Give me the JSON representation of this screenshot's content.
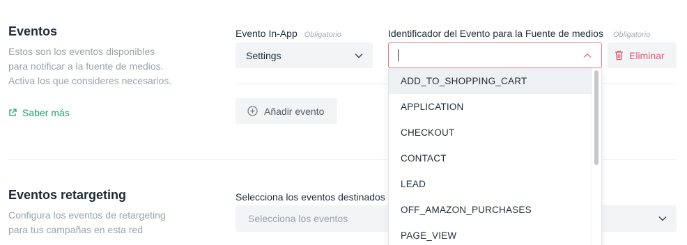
{
  "events": {
    "title": "Eventos",
    "description": "Estos son los eventos disponibles para notificar a la fuente de medios. Activa los que consideres necesarios.",
    "learn_more": "Saber más",
    "inapp_label": "Evento In-App",
    "inapp_required": "Obligatorio",
    "inapp_value": "Settings",
    "identifier_label": "Identificador del Evento para la Fuente de medios",
    "identifier_required": "Obligatorio",
    "identifier_value": "",
    "delete_label": "Eliminar",
    "add_label": "Añadir evento",
    "options": [
      "ADD_TO_SHOPPING_CART",
      "APPLICATION",
      "CHECKOUT",
      "CONTACT",
      "LEAD",
      "OFF_AMAZON_PURCHASES",
      "PAGE_VIEW"
    ]
  },
  "retargeting": {
    "title": "Eventos retargeting",
    "description": "Configura los eventos de retargeting para tus campañas en esta red",
    "select_label": "Selecciona los eventos destinados",
    "select_placeholder": "Selecciona los eventos"
  },
  "colors": {
    "accent_green": "#1f9d6b",
    "danger_red": "#e25a71",
    "field_bg": "#f2f4f6"
  }
}
